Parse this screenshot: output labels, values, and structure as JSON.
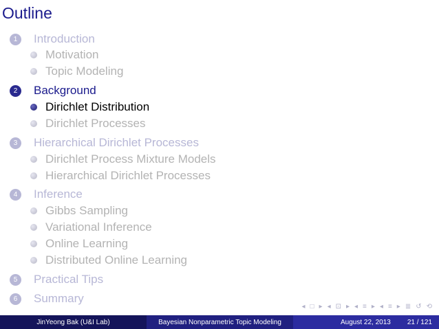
{
  "frame_title": "Outline",
  "sections": [
    {
      "num": "1",
      "label": "Introduction",
      "state": "faded",
      "subs": [
        "Motivation",
        "Topic Modeling"
      ]
    },
    {
      "num": "2",
      "label": "Background",
      "state": "active",
      "subs": [
        "Dirichlet Distribution",
        "Dirichlet Processes"
      ]
    },
    {
      "num": "3",
      "label": "Hierarchical Dirichlet Processes",
      "state": "faded",
      "subs": [
        "Dirichlet Process Mixture Models",
        "Hierarchical Dirichlet Processes"
      ]
    },
    {
      "num": "4",
      "label": "Inference",
      "state": "faded",
      "subs": [
        "Gibbs Sampling",
        "Variational Inference",
        "Online Learning",
        "Distributed Online Learning"
      ]
    },
    {
      "num": "5",
      "label": "Practical Tips",
      "state": "faded",
      "subs": []
    },
    {
      "num": "6",
      "label": "Summary",
      "state": "faded",
      "subs": []
    }
  ],
  "nav_symbols": [
    "◂",
    "□",
    "▸",
    "◂",
    "⊡",
    "▸",
    "◂",
    "≡",
    "▸",
    "◂",
    "≡",
    "▸",
    "≣",
    "↺",
    "⟲"
  ],
  "footer": {
    "author": "JinYeong Bak  (U&I Lab)",
    "title": "Bayesian Nonparametric Topic Modeling",
    "date": "August 22, 2013",
    "page": "21 / 121"
  }
}
